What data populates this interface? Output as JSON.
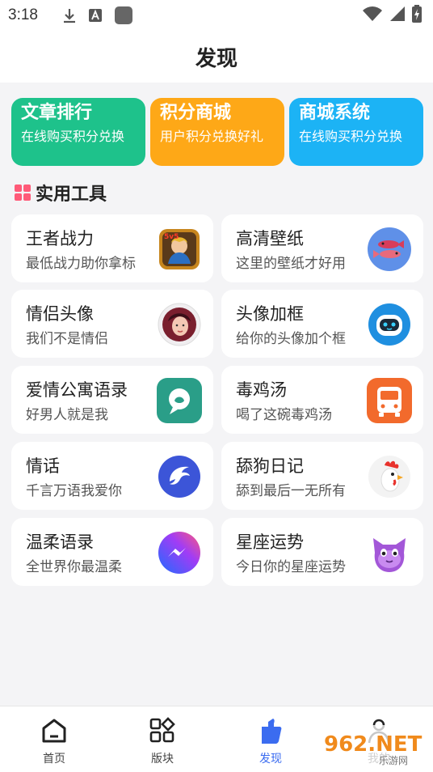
{
  "status": {
    "time": "3:18"
  },
  "page_title": "发现",
  "categories": [
    {
      "title": "文章排行",
      "subtitle": "在线购买积分兑换",
      "color": "#1ec28b"
    },
    {
      "title": "积分商城",
      "subtitle": "用户积分兑换好礼",
      "color": "#fea817"
    },
    {
      "title": "商城系统",
      "subtitle": "在线购买积分兑换",
      "color": "#1cb3f5"
    }
  ],
  "section": {
    "title": "实用工具"
  },
  "tools": [
    {
      "title": "王者战力",
      "subtitle": "最低战力助你拿标",
      "icon": "game-hero-icon"
    },
    {
      "title": "高清壁纸",
      "subtitle": "这里的壁纸才好用",
      "icon": "fish-icon"
    },
    {
      "title": "情侣头像",
      "subtitle": "我们不是情侣",
      "icon": "avatar-girl-icon"
    },
    {
      "title": "头像加框",
      "subtitle": "给你的头像加个框",
      "icon": "robot-icon"
    },
    {
      "title": "爱情公寓语录",
      "subtitle": "好男人就是我",
      "icon": "chat-bubble-icon"
    },
    {
      "title": "毒鸡汤",
      "subtitle": "喝了这碗毒鸡汤",
      "icon": "bus-icon"
    },
    {
      "title": "情话",
      "subtitle": "千言万语我爱你",
      "icon": "dolphin-icon"
    },
    {
      "title": "舔狗日记",
      "subtitle": "舔到最后一无所有",
      "icon": "rooster-icon"
    },
    {
      "title": "温柔语录",
      "subtitle": "全世界你最温柔",
      "icon": "messenger-icon"
    },
    {
      "title": "星座运势",
      "subtitle": "今日你的星座运势",
      "icon": "purple-cat-icon"
    }
  ],
  "tabs": [
    {
      "label": "首页",
      "icon": "home-icon"
    },
    {
      "label": "版块",
      "icon": "blocks-icon"
    },
    {
      "label": "发现",
      "icon": "discover-icon",
      "active": true
    },
    {
      "label": "我的",
      "icon": "profile-icon"
    }
  ],
  "watermark": {
    "text": "962.NET",
    "sub": "乐游网"
  }
}
